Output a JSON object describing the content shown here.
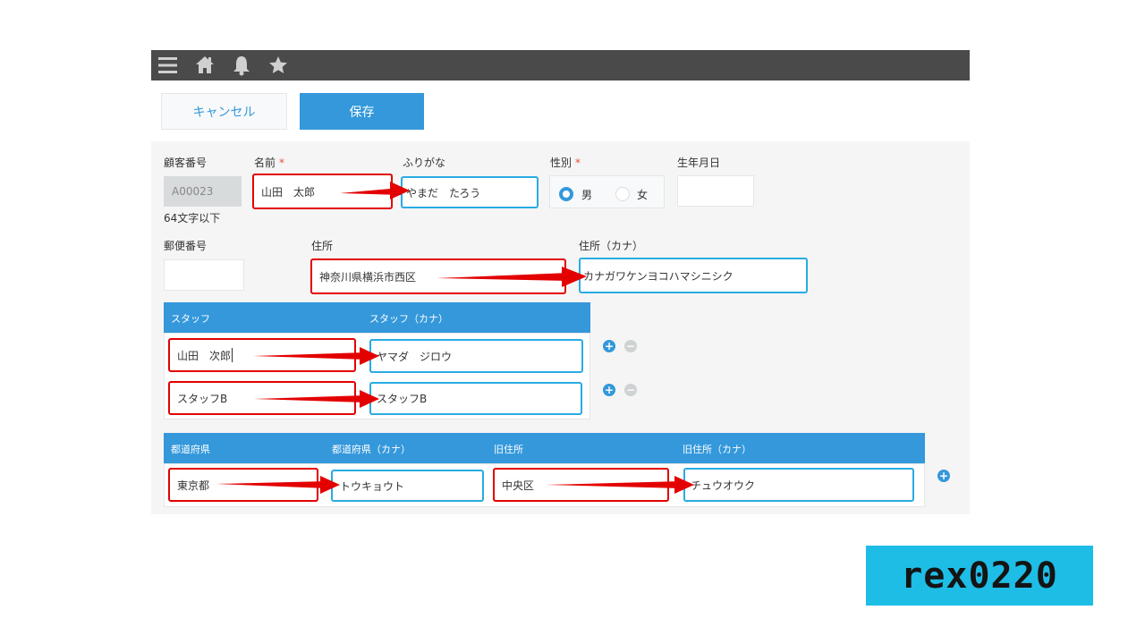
{
  "topbar": {
    "icons": [
      "menu-icon",
      "home-icon",
      "bell-icon",
      "star-icon"
    ],
    "background": "#4a4a4a"
  },
  "actions": {
    "cancel_label": "キャンセル",
    "save_label": "保存"
  },
  "customer": {
    "id_label": "顧客番号",
    "id_value": "A00023",
    "id_note": "64文字以下",
    "name_label": "名前",
    "name_value": "山田　太郎",
    "furigana_label": "ふりがな",
    "furigana_value": "やまだ　たろう",
    "gender_label": "性別",
    "gender_options": [
      "男",
      "女"
    ],
    "gender_selected": "男",
    "birth_label": "生年月日",
    "birth_value": "",
    "required_mark": "*"
  },
  "address": {
    "zip_label": "郵便番号",
    "zip_value": "",
    "address_label": "住所",
    "address_value": "神奈川県横浜市西区",
    "address_kana_label": "住所（カナ）",
    "address_kana_value": "カナガワケンヨコハマシニシク"
  },
  "staff_table": {
    "headers": [
      "スタッフ",
      "スタッフ（カナ）"
    ],
    "rows": [
      {
        "staff": "山田　次郎",
        "kana": "ヤマダ　ジロウ"
      },
      {
        "staff": "スタッフB",
        "kana": "スタッフB"
      }
    ],
    "add_symbol": "+",
    "remove_symbol": "−"
  },
  "pref_table": {
    "headers": [
      "都道府県",
      "都道府県（カナ）",
      "旧住所",
      "旧住所（カナ）"
    ],
    "rows": [
      {
        "pref": "東京都",
        "pref_kana": "トウキョウト",
        "old": "中央区",
        "old_kana": "チュウオウク"
      }
    ],
    "add_symbol": "+"
  },
  "watermark": "rex0220",
  "colors": {
    "accent": "#3498db",
    "highlight_red": "#e30000",
    "highlight_blue": "#29abe2",
    "watermark_bg": "#1ebde6"
  }
}
